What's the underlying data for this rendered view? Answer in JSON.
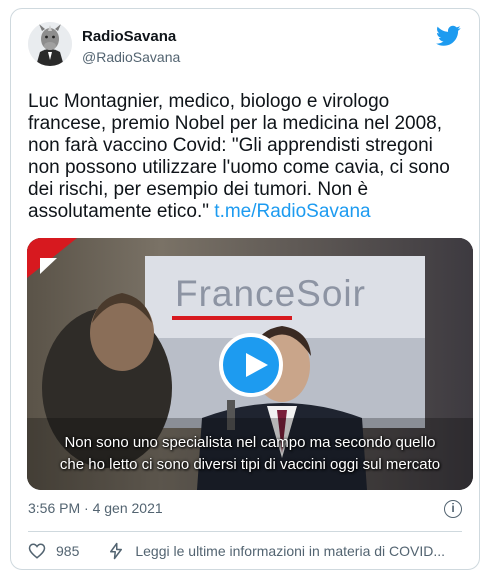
{
  "author": {
    "name": "RadioSavana",
    "handle": "@RadioSavana"
  },
  "tweet": {
    "text": "Luc Montagnier, medico, biologo e virologo\nfrancese, premio Nobel per la medicina nel 2008,\nnon farà vaccino Covid: \"Gli apprendisti stregoni\nnon possono utilizzare l'uomo come cavia, ci sono\ndei rischi, per esempio dei tumori. Non è\nassolutamente etico.\" ",
    "link": "t.me/RadioSavana"
  },
  "video": {
    "logo": "FranceSoir",
    "subtitle_line1": "Non sono uno specialista nel campo ma secondo quello",
    "subtitle_line2": "che ho letto ci sono diversi tipi di vaccini oggi sul mercato"
  },
  "meta": {
    "timestamp": "3:56 PM · 4 gen 2021"
  },
  "footer": {
    "likes": "985",
    "more_info": "Leggi le ultime informazioni in materia di COVID..."
  },
  "icons": {
    "platform": "twitter-bird-icon",
    "like": "heart-icon",
    "info": "info-icon",
    "more": "bolt-icon"
  },
  "colors": {
    "accent": "#1d9bf0",
    "text": "#0f1419",
    "secondary": "#536471",
    "brand_red": "#d7191f"
  }
}
